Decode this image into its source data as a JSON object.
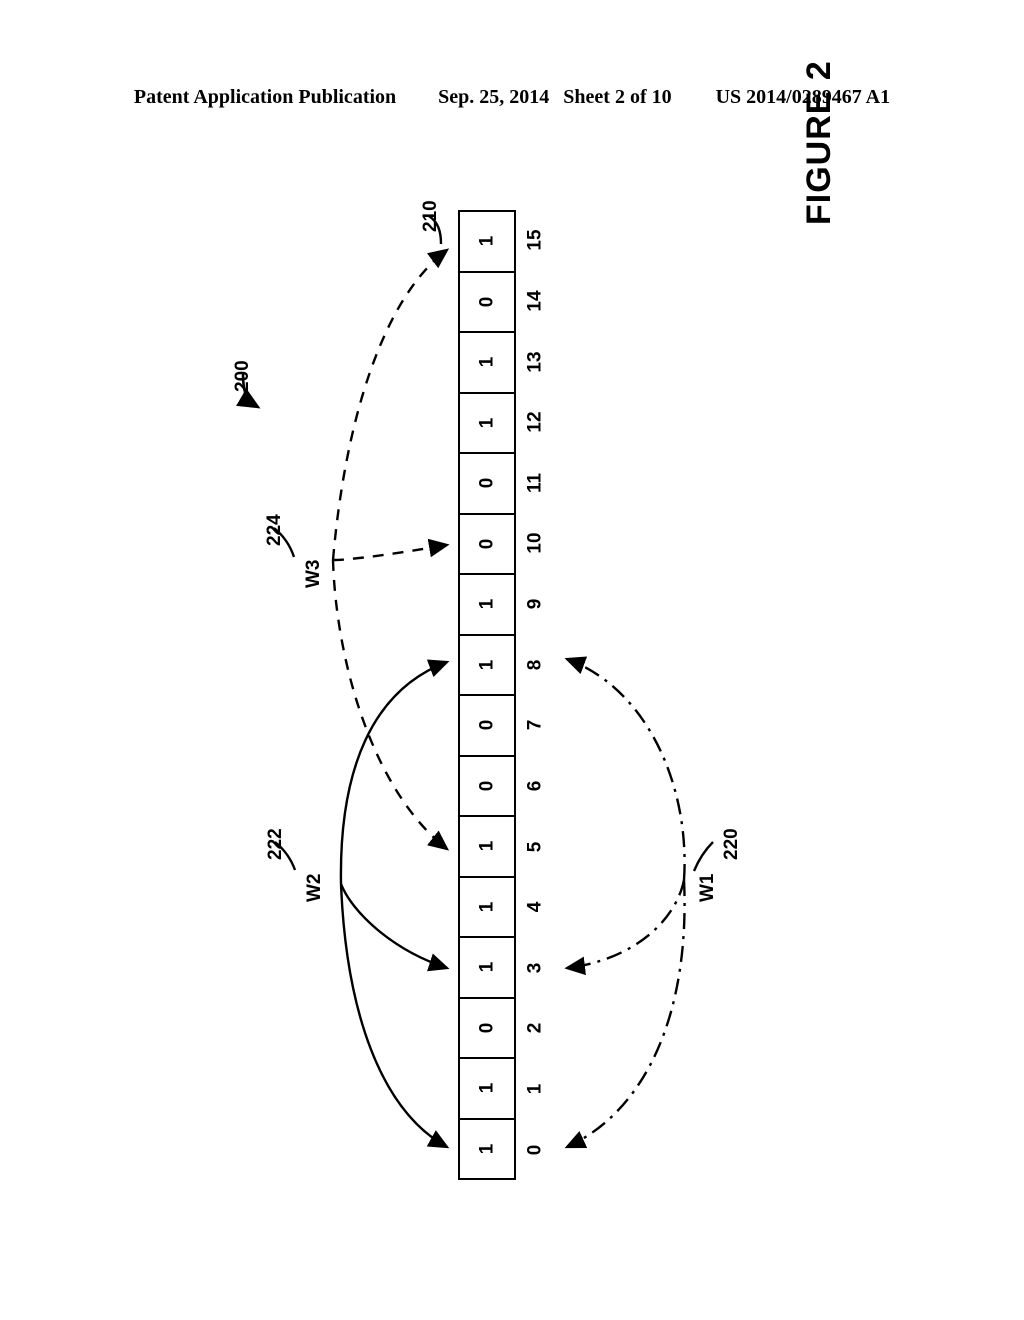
{
  "header": {
    "publication": "Patent Application Publication",
    "date": "Sep. 25, 2014",
    "sheet": "Sheet 2 of 10",
    "patent_number": "US 2014/0289467 A1"
  },
  "figure": {
    "caption": "FIGURE 2",
    "system_ref": "200",
    "array_ref": "210",
    "hash_labels": [
      {
        "name": "W1",
        "ref": "220",
        "style": "dash-dot",
        "targets": [
          8,
          3,
          0
        ]
      },
      {
        "name": "W2",
        "ref": "222",
        "style": "solid",
        "targets": [
          8,
          3,
          0
        ]
      },
      {
        "name": "W3",
        "ref": "224",
        "style": "dashed",
        "targets": [
          15,
          10,
          5
        ]
      }
    ]
  },
  "bit_array": {
    "label": "bit-array-210",
    "indices": [
      15,
      14,
      13,
      12,
      11,
      10,
      9,
      8,
      7,
      6,
      5,
      4,
      3,
      2,
      1,
      0
    ],
    "values_top_to_bottom": [
      1,
      0,
      1,
      1,
      0,
      0,
      1,
      1,
      0,
      0,
      1,
      1,
      1,
      0,
      1,
      1
    ],
    "values_by_index": {
      "0": 1,
      "1": 1,
      "2": 0,
      "3": 1,
      "4": 1,
      "5": 1,
      "6": 0,
      "7": 0,
      "8": 1,
      "9": 1,
      "10": 0,
      "11": 0,
      "12": 1,
      "13": 1,
      "14": 0,
      "15": 1
    }
  },
  "colors": {
    "ink": "#000000",
    "paper": "#ffffff"
  }
}
